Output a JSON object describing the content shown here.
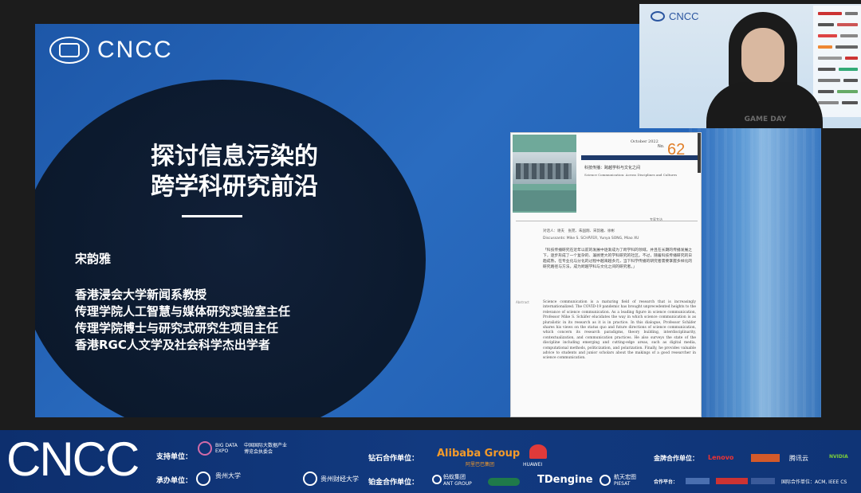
{
  "slide": {
    "logo_text": "CNCC",
    "title": [
      "探讨信息污染的",
      "跨学科研究前沿"
    ],
    "speaker": "宋韵雅",
    "roles": [
      "香港浸会大学新闻系教授",
      "传理学院人工智慧与媒体研究实验室主任",
      "传理学院博士与研究式研究生项目主任",
      "香港RGC人文学及社会科学杰出学者"
    ]
  },
  "document": {
    "month": "October 2022",
    "issue_prefix": "No.",
    "issue_number": "62",
    "heading_cn": "科技传播：跨越学科与文化之间",
    "heading_en": "Science Communication: Across Disciplines and Cultures",
    "tag": "专家专访",
    "meta_cn": "对话人：谢夫　张苑、朱国翔、宋韵雅、徐彬",
    "meta_en": "Discussants: Mike S. SCHÄFER, Yunya SONG, Miao XU",
    "label_abstract": "Abstract",
    "abstract_cn": "「科技传播研究在近年以前的发展中逐渐成为了跨学科的领域，并且在长期的传播发展之下，逐步形成了一个复杂的、兼顾更大的学科研究的社区。不过，随着科技传播研究的日趋成熟，在专业化与分化的过程中越来越多元，当下科学传播的研究者需要掌握多样化的研究路径与方法，成为跨越学科与文化之间的研究者。」",
    "abstract_en": "Science communication is a maturing field of research that is increasingly internationalized. The COVID-19 pandemic has brought unprecedented heights to the relevance of science communication. As a leading figure in science communication, Professor Mike S. Schäfer elucidates the way in which science communication is as pluralistic in its research as it is in practice. In this dialogue, Professor Schäfer shares his views on the status quo and future directions of science communication, which concern its research paradigms, theory building, interdisciplinarity, contextualization, and communication practices. He also surveys the state of the discipline including emerging and cutting-edge areas, such as digital media, computational methods, politicization, and polarization. Finally, he provides valuable advice to students and junior scholars about the makings of a good researcher in science communication."
  },
  "webcam": {
    "logo_text": "CNCC",
    "shirt_text": "GAME DAY"
  },
  "banner": {
    "logo_text": "CNCC",
    "support_label": "支持单位：",
    "support_org": "中国国际大数据产业博览会执委会",
    "support_org_short": "BIG DATA EXPO",
    "host_label": "承办单位：",
    "host_org": "贵州大学",
    "host_org2": "贵州财经大学",
    "diamond_label": "钻石合作单位：",
    "diamond_1": "Alibaba Group",
    "diamond_1_sub": "阿里巴巴集团",
    "diamond_2": "HUAWEI",
    "platinum_label": "铂金合作单位：",
    "platinum_1": "蚂蚁集团",
    "platinum_1_sub": "ANT GROUP",
    "platinum_2": "TDengine",
    "platinum_3": "航天宏图",
    "platinum_3_sub": "PIESAT",
    "gold_label": "金牌合作单位：",
    "gold_1": "Lenovo",
    "gold_2": "腾讯云",
    "gold_3": "NVIDIA",
    "media_label": "合作平台：",
    "intl_label": "国际合作单位：ACM, IEEE CS"
  },
  "colors": {
    "slide_bg": "#2463b6",
    "circle": "#0c1a2e",
    "banner_bg": "#123a80",
    "accent_orange": "#e1802b"
  }
}
